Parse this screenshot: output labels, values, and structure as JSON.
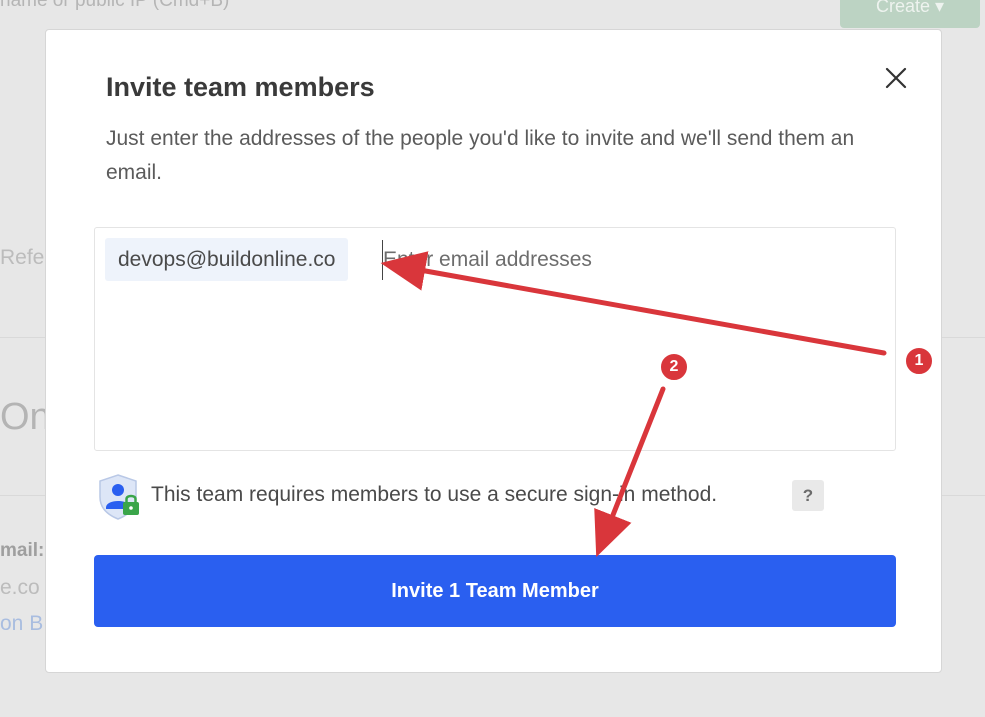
{
  "background": {
    "top_text": "name or public IP (Cmd+B)",
    "create_button": "Create ▾",
    "tab_fragment": "Refe",
    "heading_fragment": "On",
    "email_fragment": "mail:",
    "email_value_fragment": "e.co",
    "link_fragment": "on B"
  },
  "modal": {
    "title": "Invite team members",
    "description": "Just enter the addresses of the people you'd like to invite and we'll send them an email.",
    "close_icon": "close-icon",
    "email_chips": [
      "devops@buildonline.co"
    ],
    "email_input_placeholder": "Enter email addresses",
    "secure_notice": "This team requires members to use a secure sign-in method.",
    "help_label": "?",
    "invite_button": "Invite 1 Team Member",
    "shield_icon": "shield-user-lock-icon"
  },
  "annotations": {
    "badges": [
      "1",
      "2"
    ],
    "arrow_color": "#d9363b"
  },
  "colors": {
    "primary": "#2a5ff0",
    "chip_bg": "#eef3fb",
    "annotation_red": "#d9363b"
  }
}
